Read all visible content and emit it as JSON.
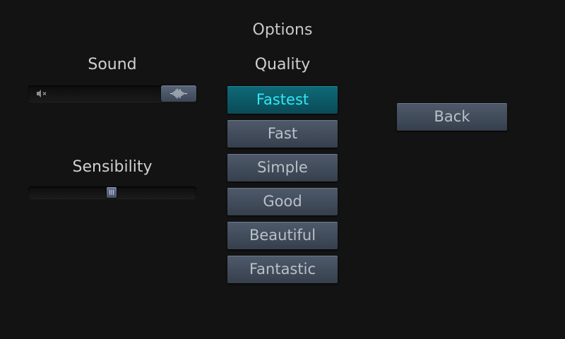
{
  "title": "Options",
  "sound": {
    "label": "Sound",
    "level": 1.0,
    "mute_icon": "speaker-mute-icon",
    "thumb_icon": "waveform-icon"
  },
  "sensibility": {
    "label": "Sensibility",
    "level": 0.5
  },
  "quality": {
    "label": "Quality",
    "options": [
      "Fastest",
      "Fast",
      "Simple",
      "Good",
      "Beautiful",
      "Fantastic"
    ],
    "selected": "Fastest"
  },
  "back_label": "Back",
  "colors": {
    "background": "#131313",
    "button": "#414c5b",
    "selected_button": "#0c5a66",
    "selected_text": "#2ee8f4",
    "text": "#c8c8c8"
  }
}
